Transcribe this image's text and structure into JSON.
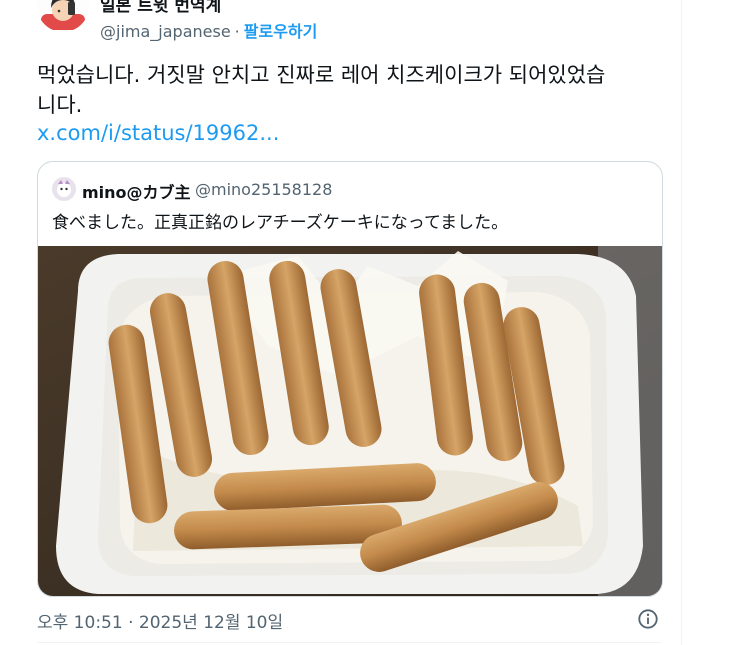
{
  "author": {
    "display_name": "일본 트윗 번역계",
    "handle": "@jima_japanese",
    "separator": "·",
    "follow_label": "팔로우하기"
  },
  "tweet": {
    "text": "먹었습니다. 거짓말 안치고 진짜로 레어 치즈케이크가 되어있었습\n니다.",
    "link_text": "x.com/i/status/19962..."
  },
  "quoted_tweet": {
    "display_name": "mino@カブ主",
    "handle": "@mino25158128",
    "text": "食べました。正真正銘のレアチーズケーキになってました。"
  },
  "meta": {
    "timestamp": "오후 10:51 · 2025년 12월 10일"
  },
  "colors": {
    "link": "#1d9bf0",
    "secondary_text": "#536471",
    "border": "#cfd9de"
  },
  "icons": {
    "info": "info-circle-icon"
  }
}
